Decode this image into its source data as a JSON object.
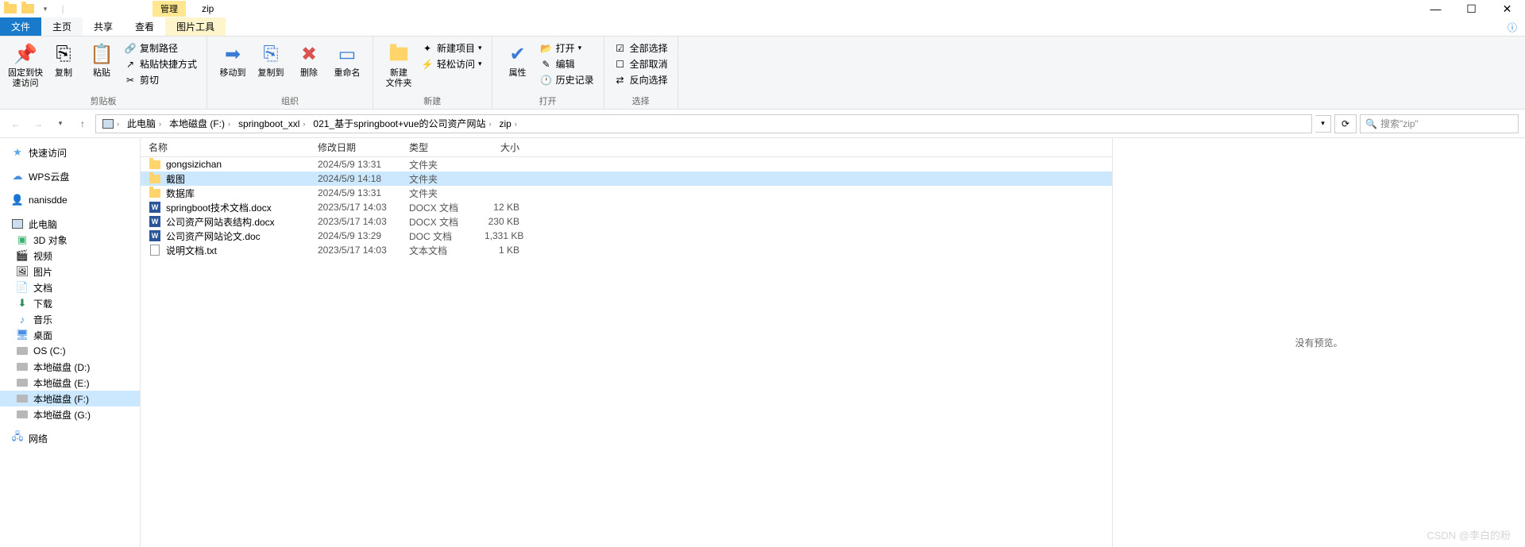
{
  "title_tab": "管理",
  "window_title": "zip",
  "ribbon_tabs": {
    "file": "文件",
    "home": "主页",
    "share": "共享",
    "view": "查看",
    "tools": "图片工具"
  },
  "ribbon": {
    "clipboard": {
      "pin": "固定到快\n速访问",
      "copy": "复制",
      "paste": "粘贴",
      "copy_path": "复制路径",
      "paste_shortcut": "粘贴快捷方式",
      "cut": "剪切",
      "label": "剪贴板"
    },
    "organize": {
      "move_to": "移动到",
      "copy_to": "复制到",
      "delete": "删除",
      "rename": "重命名",
      "label": "组织"
    },
    "new": {
      "new_folder": "新建\n文件夹",
      "new_item": "新建项目",
      "easy_access": "轻松访问",
      "label": "新建"
    },
    "open": {
      "properties": "属性",
      "open": "打开",
      "edit": "编辑",
      "history": "历史记录",
      "label": "打开"
    },
    "select": {
      "select_all": "全部选择",
      "select_none": "全部取消",
      "invert": "反向选择",
      "label": "选择"
    }
  },
  "breadcrumb": [
    "此电脑",
    "本地磁盘 (F:)",
    "springboot_xxl",
    "021_基于springboot+vue的公司资产网站",
    "zip"
  ],
  "search_placeholder": "搜索\"zip\"",
  "columns": {
    "name": "名称",
    "date": "修改日期",
    "type": "类型",
    "size": "大小"
  },
  "sidebar": {
    "quick": "快速访问",
    "wps": "WPS云盘",
    "user": "nanisdde",
    "pc": "此电脑",
    "pc_items": [
      "3D 对象",
      "视频",
      "图片",
      "文档",
      "下载",
      "音乐",
      "桌面",
      "OS (C:)",
      "本地磁盘 (D:)",
      "本地磁盘 (E:)",
      "本地磁盘 (F:)",
      "本地磁盘 (G:)"
    ],
    "network": "网络"
  },
  "files": [
    {
      "name": "gongsizichan",
      "date": "2024/5/9 13:31",
      "type": "文件夹",
      "size": "",
      "icon": "folder"
    },
    {
      "name": "截图",
      "date": "2024/5/9 14:18",
      "type": "文件夹",
      "size": "",
      "icon": "folder",
      "selected": true
    },
    {
      "name": "数据库",
      "date": "2024/5/9 13:31",
      "type": "文件夹",
      "size": "",
      "icon": "folder"
    },
    {
      "name": "springboot技术文档.docx",
      "date": "2023/5/17 14:03",
      "type": "DOCX 文档",
      "size": "12 KB",
      "icon": "word"
    },
    {
      "name": "公司资产网站表结构.docx",
      "date": "2023/5/17 14:03",
      "type": "DOCX 文档",
      "size": "230 KB",
      "icon": "word"
    },
    {
      "name": "公司资产网站论文.doc",
      "date": "2024/5/9 13:29",
      "type": "DOC 文档",
      "size": "1,331 KB",
      "icon": "word"
    },
    {
      "name": "说明文档.txt",
      "date": "2023/5/17 14:03",
      "type": "文本文档",
      "size": "1 KB",
      "icon": "txt"
    }
  ],
  "preview_text": "没有预览。",
  "watermark": "CSDN @李白的粉"
}
